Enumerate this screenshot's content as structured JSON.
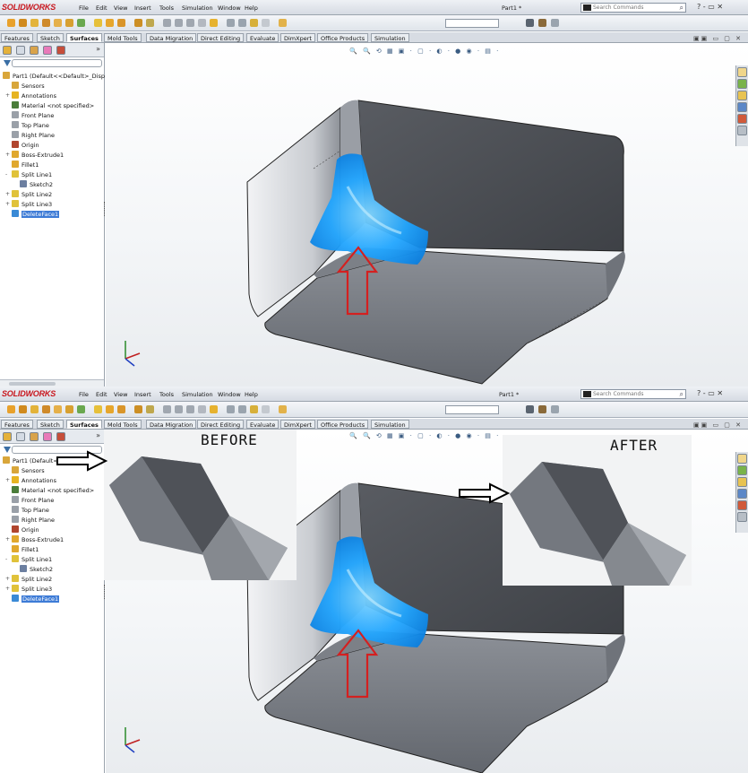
{
  "app": {
    "logo_text": "SOLIDWORKS",
    "document_title": "Part1 *",
    "menu": [
      "File",
      "Edit",
      "View",
      "Insert",
      "Tools",
      "Simulation",
      "Window",
      "Help"
    ],
    "search_placeholder": "Search Commands",
    "window_controls": "? - ▭ ✕"
  },
  "command_tabs": [
    {
      "label": "Features",
      "active": false
    },
    {
      "label": "Sketch",
      "active": false
    },
    {
      "label": "Surfaces",
      "active": true
    },
    {
      "label": "Mold Tools",
      "active": false
    },
    {
      "label": "Data Migration",
      "active": false
    },
    {
      "label": "Direct Editing",
      "active": false
    },
    {
      "label": "Evaluate",
      "active": false
    },
    {
      "label": "DimXpert",
      "active": false
    },
    {
      "label": "Office Products",
      "active": false
    },
    {
      "label": "Simulation",
      "active": false
    }
  ],
  "feature_tree": {
    "root": "Part1  (Default<<Default>_Disp",
    "items": [
      {
        "label": "Sensors",
        "icon": "sensor-icon",
        "expand": "",
        "color": "#d8a63a"
      },
      {
        "label": "Annotations",
        "icon": "annotation-icon",
        "expand": "+",
        "color": "#e6b422"
      },
      {
        "label": "Material <not specified>",
        "icon": "material-icon",
        "expand": "",
        "color": "#4a7d3a"
      },
      {
        "label": "Front Plane",
        "icon": "plane-icon",
        "expand": "",
        "color": "#9aa0a8"
      },
      {
        "label": "Top Plane",
        "icon": "plane-icon",
        "expand": "",
        "color": "#9aa0a8"
      },
      {
        "label": "Right Plane",
        "icon": "plane-icon",
        "expand": "",
        "color": "#9aa0a8"
      },
      {
        "label": "Origin",
        "icon": "origin-icon",
        "expand": "",
        "color": "#b0452e"
      },
      {
        "label": "Boss-Extrude1",
        "icon": "extrude-icon",
        "expand": "+",
        "color": "#e0a82e"
      },
      {
        "label": "Fillet1",
        "icon": "fillet-icon",
        "expand": "",
        "color": "#e0a82e"
      },
      {
        "label": "Split Line1",
        "icon": "split-line-icon",
        "expand": "-",
        "color": "#e0c23a"
      },
      {
        "label": "Sketch2",
        "icon": "sketch-icon",
        "expand": "",
        "color": "#6c7fa0",
        "indent": true
      },
      {
        "label": "Split Line2",
        "icon": "split-line-icon",
        "expand": "+",
        "color": "#e0c23a"
      },
      {
        "label": "Split Line3",
        "icon": "split-line-icon",
        "expand": "+",
        "color": "#e0c23a"
      },
      {
        "label": "DeleteFace1",
        "icon": "delete-face-icon",
        "expand": "",
        "color": "#3a8ad6",
        "selected": true
      }
    ]
  },
  "heads_up_toolbar": "🔍 🔍 ⟲ ▦ ▣ · ▢ · ◐ · ● ◉ · ▤ ·",
  "insets": {
    "before_label": "BEFORE",
    "after_label": "AFTER"
  },
  "colors": {
    "selected_face": "#1aa3ff",
    "arrow": "#d42020",
    "body_dark": "#4c4f55",
    "body_light": "#8d9198"
  }
}
